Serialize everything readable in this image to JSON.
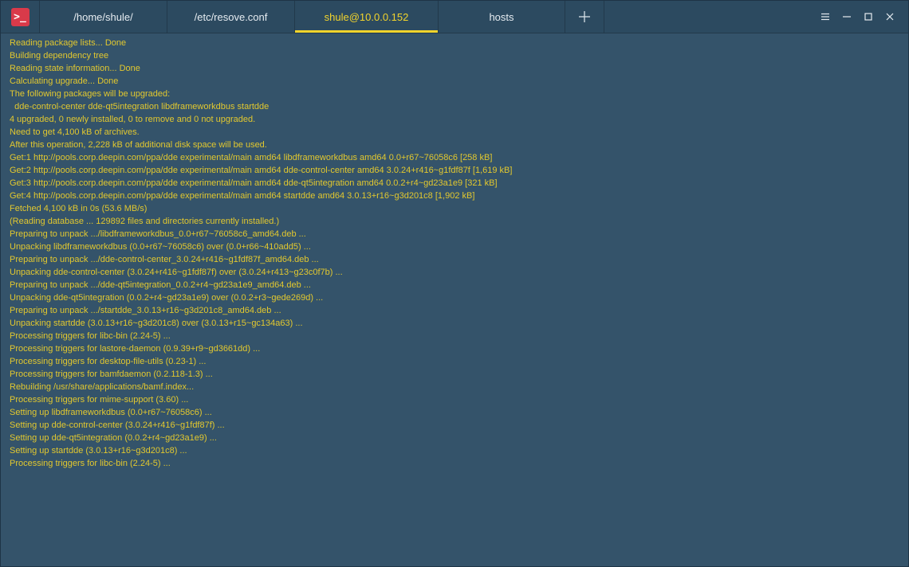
{
  "app": {
    "icon_glyph": ">_"
  },
  "colors": {
    "accent": "#f2d42c",
    "background": "#34536a",
    "titlebar": "#2c4a60",
    "app_icon": "#d93a4a"
  },
  "tabs": [
    {
      "label": "/home/shule/",
      "active": false
    },
    {
      "label": "/etc/resove.conf",
      "active": false
    },
    {
      "label": "shule@10.0.0.152",
      "active": true
    },
    {
      "label": "hosts",
      "active": false
    }
  ],
  "icons": {
    "add_tab": "plus-icon",
    "menu": "hamburger-menu-icon",
    "minimize": "minimize-icon",
    "maximize": "maximize-icon",
    "close": "close-icon"
  },
  "terminal": {
    "lines": [
      "Reading package lists... Done",
      "Building dependency tree",
      "Reading state information... Done",
      "Calculating upgrade... Done",
      "The following packages will be upgraded:",
      "  dde-control-center dde-qt5integration libdframeworkdbus startdde",
      "4 upgraded, 0 newly installed, 0 to remove and 0 not upgraded.",
      "Need to get 4,100 kB of archives.",
      "After this operation, 2,228 kB of additional disk space will be used.",
      "Get:1 http://pools.corp.deepin.com/ppa/dde experimental/main amd64 libdframeworkdbus amd64 0.0+r67~76058c6 [258 kB]",
      "Get:2 http://pools.corp.deepin.com/ppa/dde experimental/main amd64 dde-control-center amd64 3.0.24+r416~g1fdf87f [1,619 kB]",
      "Get:3 http://pools.corp.deepin.com/ppa/dde experimental/main amd64 dde-qt5integration amd64 0.0.2+r4~gd23a1e9 [321 kB]",
      "Get:4 http://pools.corp.deepin.com/ppa/dde experimental/main amd64 startdde amd64 3.0.13+r16~g3d201c8 [1,902 kB]",
      "Fetched 4,100 kB in 0s (53.6 MB/s)",
      "(Reading database ... 129892 files and directories currently installed.)",
      "Preparing to unpack .../libdframeworkdbus_0.0+r67~76058c6_amd64.deb ...",
      "Unpacking libdframeworkdbus (0.0+r67~76058c6) over (0.0+r66~410add5) ...",
      "Preparing to unpack .../dde-control-center_3.0.24+r416~g1fdf87f_amd64.deb ...",
      "Unpacking dde-control-center (3.0.24+r416~g1fdf87f) over (3.0.24+r413~g23c0f7b) ...",
      "Preparing to unpack .../dde-qt5integration_0.0.2+r4~gd23a1e9_amd64.deb ...",
      "Unpacking dde-qt5integration (0.0.2+r4~gd23a1e9) over (0.0.2+r3~gede269d) ...",
      "Preparing to unpack .../startdde_3.0.13+r16~g3d201c8_amd64.deb ...",
      "Unpacking startdde (3.0.13+r16~g3d201c8) over (3.0.13+r15~gc134a63) ...",
      "Processing triggers for libc-bin (2.24-5) ...",
      "Processing triggers for lastore-daemon (0.9.39+r9~gd3661dd) ...",
      "Processing triggers for desktop-file-utils (0.23-1) ...",
      "Processing triggers for bamfdaemon (0.2.118-1.3) ...",
      "Rebuilding /usr/share/applications/bamf.index...",
      "Processing triggers for mime-support (3.60) ...",
      "Setting up libdframeworkdbus (0.0+r67~76058c6) ...",
      "Setting up dde-control-center (3.0.24+r416~g1fdf87f) ...",
      "Setting up dde-qt5integration (0.0.2+r4~gd23a1e9) ...",
      "Setting up startdde (3.0.13+r16~g3d201c8) ...",
      "Processing triggers for libc-bin (2.24-5) ..."
    ]
  }
}
